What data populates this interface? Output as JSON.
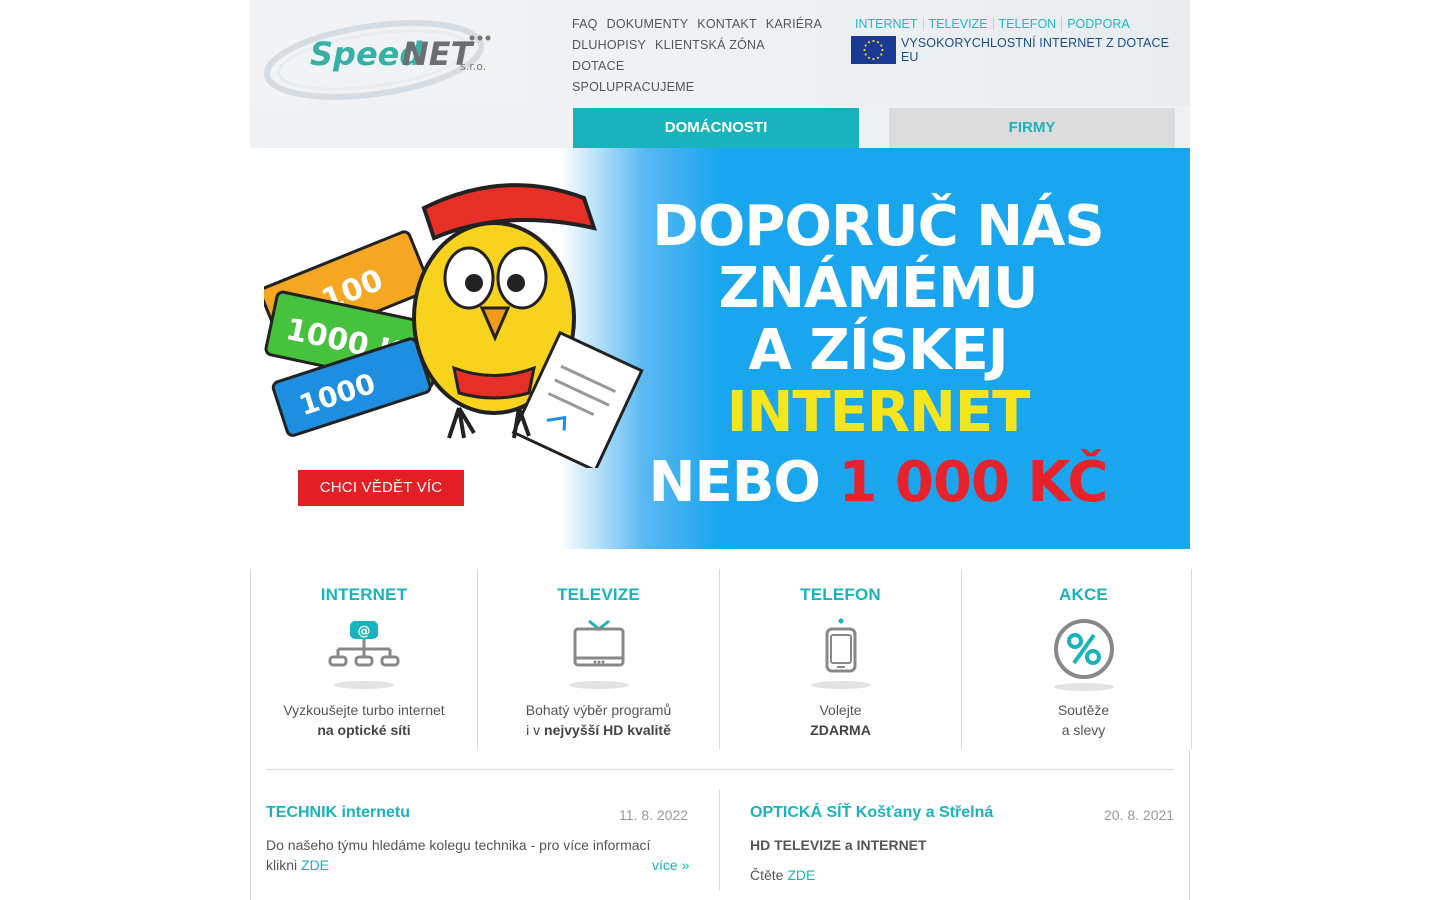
{
  "header": {
    "logo": {
      "text": "SpeedNET",
      "suffix": "s.r.o."
    },
    "nav_top": [
      "FAQ",
      "DOKUMENTY",
      "KONTAKT",
      "KARIÉRA",
      "DLUHOPISY",
      "KLIENTSKÁ ZÓNA",
      "DOTACE",
      "SPOLUPRACUJEME"
    ],
    "nav_right": [
      "INTERNET",
      "TELEVIZE",
      "TELEFON",
      "PODPORA"
    ],
    "eu_text": "VYSOKORYCHLOSTNÍ INTERNET Z DOTACE EU",
    "tabs": {
      "home": "DOMÁCNOSTI",
      "firms": "FIRMY"
    }
  },
  "banner": {
    "line1": "DOPORUČ NÁS",
    "line2": "ZNÁMÉMU",
    "line3": "A ZÍSKEJ",
    "line4": "INTERNET",
    "line5_prefix": "NEBO",
    "line5_amount": "1 000 KČ",
    "cta": "CHCI VĚDĚT VÍC",
    "voucher_text": "1000 Kč"
  },
  "services": [
    {
      "title": "INTERNET",
      "line1": "Vyzkoušejte turbo internet",
      "line2": "na optické síti",
      "icon": "network-icon"
    },
    {
      "title": "TELEVIZE",
      "line1": "Bohatý výběr programů",
      "line2_prefix": "i v ",
      "line2": "nejvyšší HD kvalitě",
      "icon": "tv-icon"
    },
    {
      "title": "TELEFON",
      "line1": "Volejte",
      "line2": "ZDARMA",
      "icon": "phone-icon"
    },
    {
      "title": "AKCE",
      "line1": "Soutěže",
      "line2": "a slevy",
      "icon": "percent-icon"
    }
  ],
  "news": [
    {
      "title": "TECHNIK internetu",
      "date": "11. 8. 2022",
      "text": "Do našeho týmu hledáme kolegu technika - pro více informací",
      "text2_prefix": "klikni ",
      "link": "ZDE",
      "more": "více »"
    },
    {
      "title": "OPTICKÁ SÍŤ Košťany a Střelná",
      "date": "20. 8. 2021",
      "subtitle": "HD TELEVIZE a INTERNET",
      "text_prefix": "Čtěte ",
      "link": "ZDE"
    }
  ],
  "colors": {
    "accent": "#18b3bd",
    "banner_blue": "#1aa6ee",
    "cta_red": "#e31e24",
    "yellow": "#f4e51c"
  }
}
